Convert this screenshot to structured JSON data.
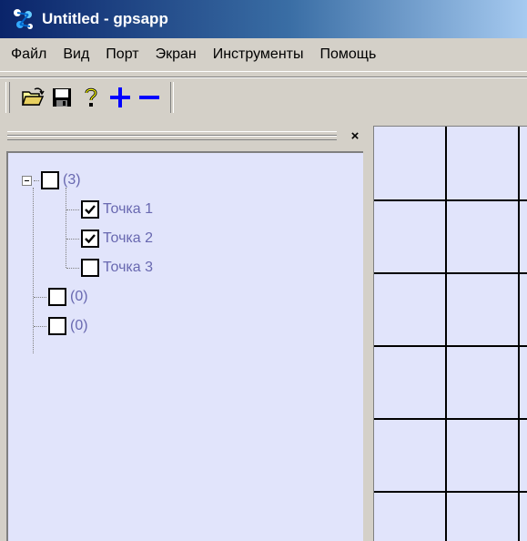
{
  "window": {
    "title": "Untitled - gpsapp",
    "title_color": "#0a246a"
  },
  "menu": {
    "items": [
      "Файл",
      "Вид",
      "Порт",
      "Экран",
      "Инструменты",
      "Помощь"
    ]
  },
  "toolbar": {
    "buttons": [
      "open-folder-icon",
      "save-icon",
      "help-icon",
      "zoom-in-icon",
      "zoom-out-icon"
    ],
    "accent_color": "#0000ff"
  },
  "panel": {
    "close_label": "×"
  },
  "tree": {
    "text_color": "#6868b0",
    "background": "#e1e4fb",
    "groups": [
      {
        "label": "(3)",
        "checked": false,
        "expanded": true,
        "children": [
          {
            "label": "Точка 1",
            "checked": true
          },
          {
            "label": "Точка 2",
            "checked": true
          },
          {
            "label": "Точка 3",
            "checked": false
          }
        ]
      },
      {
        "label": "(0)",
        "checked": false
      },
      {
        "label": "(0)",
        "checked": false
      }
    ]
  }
}
